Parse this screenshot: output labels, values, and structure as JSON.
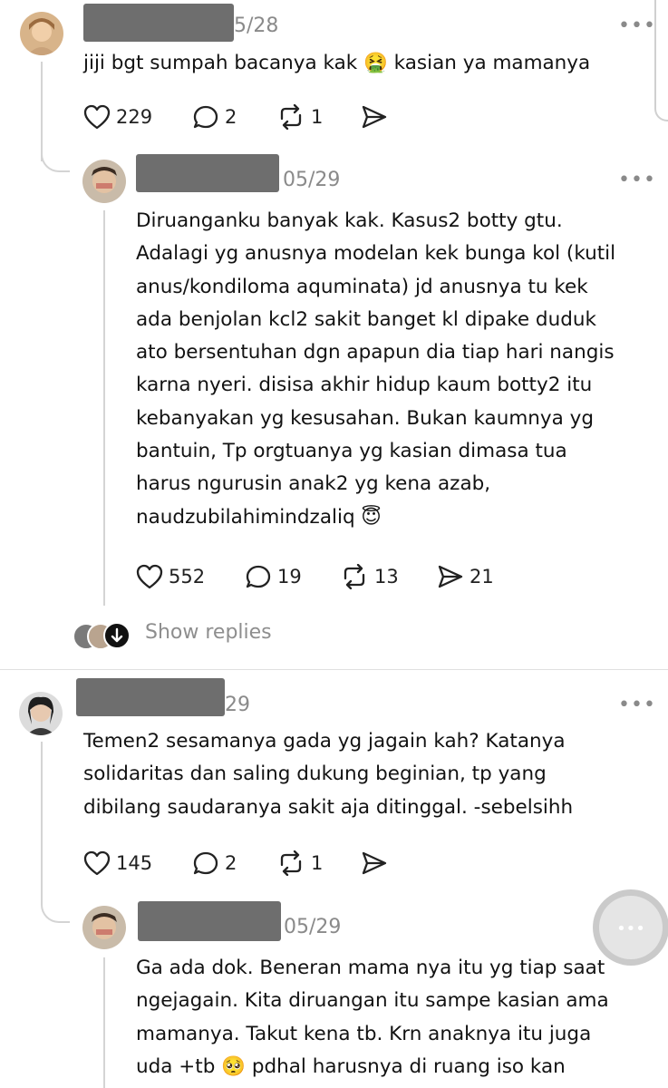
{
  "comments": [
    {
      "date": "5/28",
      "text": "jiji bgt sumpah bacanya kak 🤮 kasian ya mamanya",
      "likes": "229",
      "replies": "2",
      "reposts": "1"
    },
    {
      "date": "05/29",
      "text": "Diruanganku banyak kak. Kasus2 botty gtu.\nAdalagi yg anusnya modelan kek bunga kol (kutil\nanus/kondiloma aquminata) jd anusnya tu kek\nada benjolan kcl2 sakit banget kl dipake duduk\nato bersentuhan dgn apapun dia tiap hari nangis\nkarna nyeri. disisa akhir hidup kaum botty2 itu\nkebanyakan yg kesusahan. Bukan kaumnya yg\nbantuin, Tp orgtuanya yg kasian dimasa tua\nharus ngurusin anak2 yg kena azab,\nnaudzubilahimindzaliq 😇",
      "likes": "552",
      "replies": "19",
      "reposts": "13",
      "shares": "21"
    },
    {
      "date": "29",
      "text": "Temen2 sesamanya gada yg jagain kah? Katanya\nsolidaritas dan saling dukung beginian, tp yang\ndibilang saudaranya sakit aja ditinggal. -sebelsihh",
      "likes": "145",
      "replies": "2",
      "reposts": "1"
    },
    {
      "date": "05/29",
      "text": "Ga ada dok. Beneran mama nya itu yg tiap saat\nngejagain. Kita diruangan itu sampe kasian ama\nmamanya. Takut kena tb. Krn anaknya itu juga\nuda +tb 🥺 pdhal harusnya di ruang iso kan"
    }
  ],
  "show_replies": "Show replies",
  "more_glyph": "•••",
  "icons": [
    "heart-icon",
    "comment-icon",
    "repost-icon",
    "share-icon",
    "more-icon",
    "arrow-down-icon"
  ],
  "colors": {
    "text": "#121212",
    "muted": "#8a8a8a",
    "redaction": "#6e6e6e",
    "thread_line": "#d4d4d4"
  }
}
